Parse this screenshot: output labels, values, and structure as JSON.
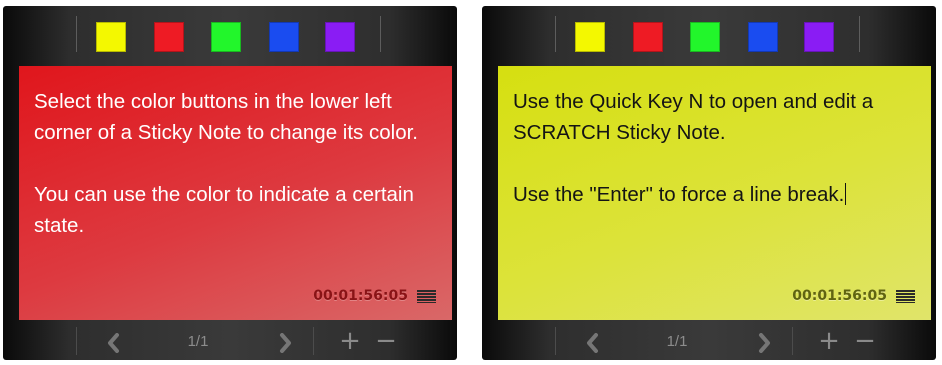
{
  "colors": {
    "yellow": "#f4f800",
    "red": "#ee1b24",
    "green": "#22f62b",
    "blue": "#1a4cf0",
    "purple": "#8a1cf4"
  },
  "swatches": [
    {
      "name": "yellow",
      "color": "#f4f800"
    },
    {
      "name": "red",
      "color": "#ee1b24"
    },
    {
      "name": "green",
      "color": "#22f62b"
    },
    {
      "name": "blue",
      "color": "#1a4cf0"
    },
    {
      "name": "purple",
      "color": "#8a1cf4"
    }
  ],
  "notes": [
    {
      "color": "red",
      "paragraphs": [
        "Select the color buttons in the lower left corner of a Sticky Note to change its color.",
        "You can use the color to indicate a certain state."
      ],
      "timestamp": "00:01:56:05",
      "page": "1/1"
    },
    {
      "color": "yellow",
      "paragraphs": [
        "Use the Quick Key N to open and edit a SCRATCH Sticky Note.",
        "Use the \"Enter\" to force a line break."
      ],
      "timestamp": "00:01:56:05",
      "page": "1/1"
    }
  ],
  "nav": {
    "prev_icon": "chevron-left-icon",
    "next_icon": "chevron-right-icon",
    "add_label": "+",
    "remove_label": "−"
  }
}
